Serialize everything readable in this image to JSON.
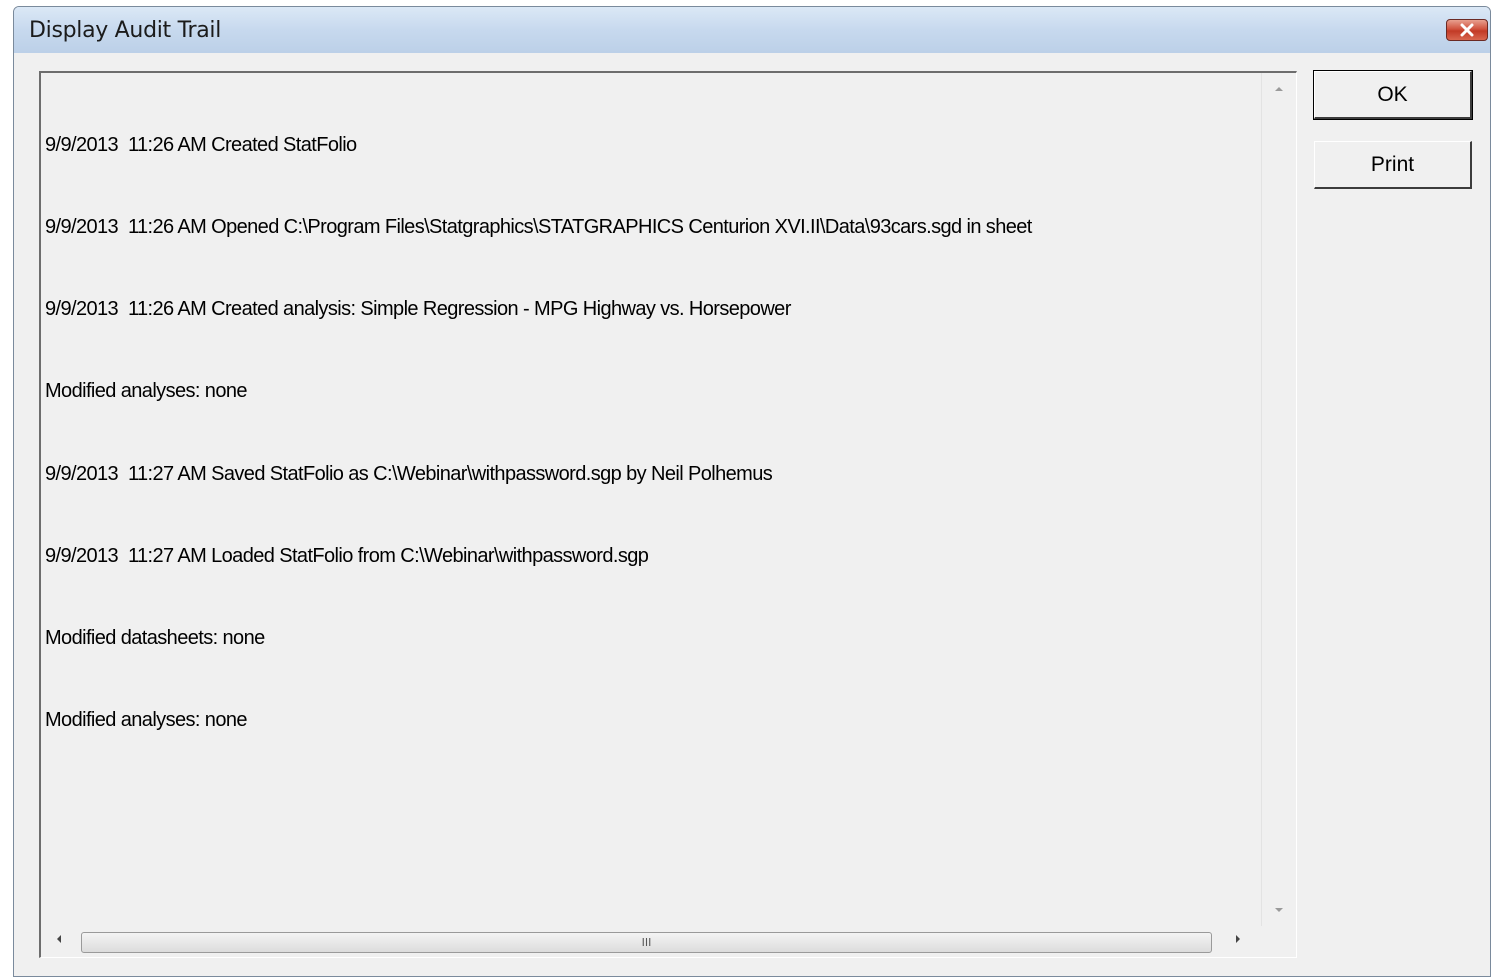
{
  "window": {
    "title": "Display Audit Trail"
  },
  "log": {
    "lines": [
      "9/9/2013  11:26 AM Created StatFolio",
      "9/9/2013  11:26 AM Opened C:\\Program Files\\Statgraphics\\STATGRAPHICS Centurion XVI.II\\Data\\93cars.sgd in sheet",
      "9/9/2013  11:26 AM Created analysis: Simple Regression - MPG Highway vs. Horsepower",
      "Modified analyses: none",
      "9/9/2013  11:27 AM Saved StatFolio as C:\\Webinar\\withpassword.sgp by Neil Polhemus",
      "9/9/2013  11:27 AM Loaded StatFolio from C:\\Webinar\\withpassword.sgp",
      "Modified datasheets: none",
      "Modified analyses: none"
    ]
  },
  "buttons": {
    "ok": "OK",
    "print": "Print"
  },
  "scrollbar": {
    "grip": "III"
  },
  "icons": {
    "close": "close-icon",
    "up": "arrow-up-icon",
    "down": "arrow-down-icon",
    "left": "arrow-left-icon",
    "right": "arrow-right-icon"
  },
  "colors": {
    "close_button": "#c94a35",
    "titlebar": "#c7d9ee",
    "dialog_bg": "#f0f0f0"
  }
}
